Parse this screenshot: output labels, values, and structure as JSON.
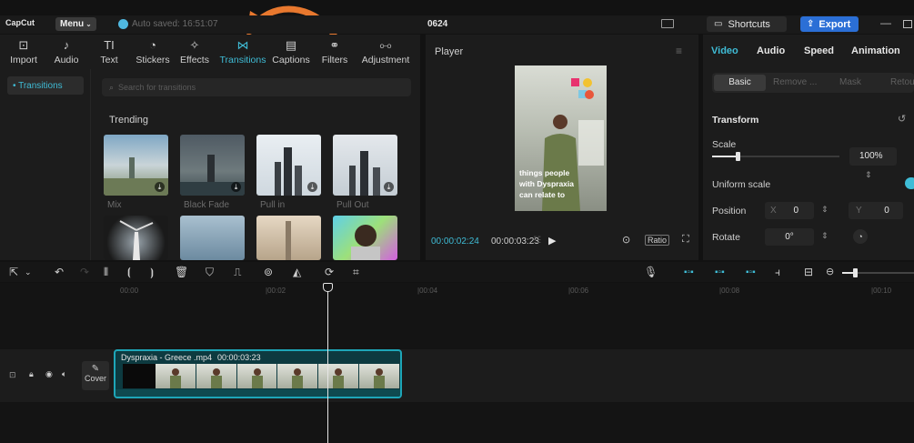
{
  "titlebar": {
    "logo": "CapCut",
    "menu_label": "Menu",
    "autosave": "Auto saved: 16:51:07",
    "project_name": "0624",
    "shortcuts_label": "Shortcuts",
    "export_label": "Export",
    "min_label": "—"
  },
  "tools": [
    {
      "label": "Import",
      "icon": "import-icon",
      "glyph": "⊡"
    },
    {
      "label": "Audio",
      "icon": "audio-icon",
      "glyph": "♪"
    },
    {
      "label": "Text",
      "icon": "text-icon",
      "glyph": "TI"
    },
    {
      "label": "Stickers",
      "icon": "sticker-icon",
      "glyph": "◔"
    },
    {
      "label": "Effects",
      "icon": "effects-icon",
      "glyph": "✧"
    },
    {
      "label": "Transitions",
      "icon": "transitions-icon",
      "glyph": "⋈"
    },
    {
      "label": "Captions",
      "icon": "captions-icon",
      "glyph": "▤"
    },
    {
      "label": "Filters",
      "icon": "filters-icon",
      "glyph": "⚭"
    },
    {
      "label": "Adjustment",
      "icon": "adjustment-icon",
      "glyph": "⧟"
    }
  ],
  "sidebar": {
    "active_item": "• Transitions"
  },
  "search": {
    "placeholder": "Search for transitions"
  },
  "trending": {
    "heading": "Trending",
    "items": [
      {
        "label": "Mix"
      },
      {
        "label": "Black Fade"
      },
      {
        "label": "Pull in"
      },
      {
        "label": "Pull Out"
      }
    ]
  },
  "player": {
    "title": "Player",
    "current_time": "00:00:02:24",
    "total_time": "00:00:03:23",
    "ratio_label": "Ratio",
    "caption_lines": [
      "things people",
      "with Dyspraxia",
      "can relate to"
    ]
  },
  "properties": {
    "tabs": [
      "Video",
      "Audio",
      "Speed",
      "Animation"
    ],
    "subtabs": [
      "Basic",
      "Remove ...",
      "Mask",
      "Retou"
    ],
    "transform_label": "Transform",
    "scale_label": "Scale",
    "scale_value": "100%",
    "uniform_scale_label": "Uniform scale",
    "position_label": "Position",
    "pos_x_label": "X",
    "pos_x_value": "0",
    "pos_y_label": "Y",
    "pos_y_value": "0",
    "rotate_label": "Rotate",
    "rotate_value": "0°"
  },
  "timeline": {
    "ruler_ticks": [
      "00:00",
      "|00:02",
      "|00:04",
      "|00:06",
      "|00:08",
      "|00:10"
    ],
    "clip_name": "Dyspraxia - Greece .mp4",
    "clip_duration": "00:00:03:23",
    "cover_label": "Cover"
  },
  "colors": {
    "accent": "#3fbcd6",
    "export": "#2b6fd6",
    "annotation_arrow": "#e8782e"
  }
}
